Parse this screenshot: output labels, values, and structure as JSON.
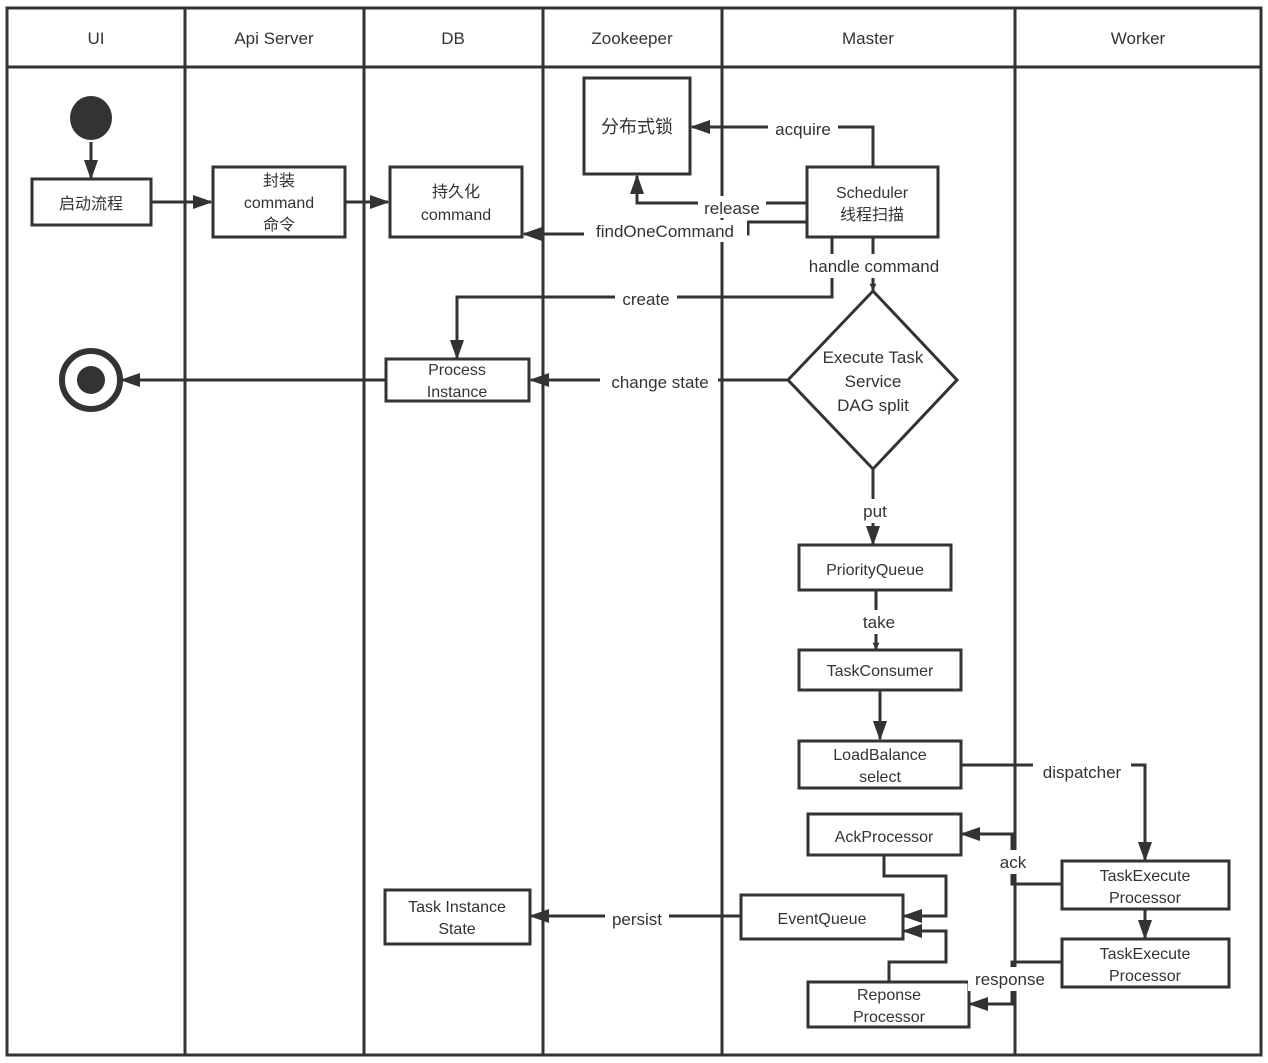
{
  "lanes": [
    {
      "id": "ui",
      "title": "UI"
    },
    {
      "id": "api",
      "title": "Api Server"
    },
    {
      "id": "db",
      "title": "DB"
    },
    {
      "id": "zk",
      "title": "Zookeeper"
    },
    {
      "id": "master",
      "title": "Master"
    },
    {
      "id": "worker",
      "title": "Worker"
    }
  ],
  "nodes": {
    "start": {
      "kind": "start",
      "label": ""
    },
    "end": {
      "kind": "end",
      "label": ""
    },
    "start_process": {
      "lines": [
        "启动流程"
      ]
    },
    "wrap_command": {
      "lines": [
        "封装",
        "command",
        "命令"
      ]
    },
    "persist_command": {
      "lines": [
        "持久化",
        "command"
      ]
    },
    "distributed_lock": {
      "lines": [
        "分布式锁"
      ]
    },
    "scheduler": {
      "lines": [
        "Scheduler",
        "线程扫描"
      ]
    },
    "process_instance": {
      "lines": [
        "Process",
        "Instance"
      ]
    },
    "execute_task_service": {
      "lines": [
        "Execute Task",
        "Service",
        "DAG split"
      ]
    },
    "priority_queue": {
      "lines": [
        "PriorityQueue"
      ]
    },
    "task_consumer": {
      "lines": [
        "TaskConsumer"
      ]
    },
    "load_balance": {
      "lines": [
        "LoadBalance",
        "select"
      ]
    },
    "ack_processor": {
      "lines": [
        "AckProcessor"
      ]
    },
    "event_queue": {
      "lines": [
        "EventQueue"
      ]
    },
    "response_processor": {
      "lines": [
        "Reponse",
        "Processor"
      ]
    },
    "task_instance_state": {
      "lines": [
        "Task Instance",
        "State"
      ]
    },
    "task_execute_processor_1": {
      "lines": [
        "TaskExecute",
        "Processor"
      ]
    },
    "task_execute_processor_2": {
      "lines": [
        "TaskExecute",
        "Processor"
      ]
    }
  },
  "edges": {
    "acquire": "acquire",
    "release": "release",
    "find_one_command": "findOneCommand",
    "handle_command": "handle command",
    "create": "create",
    "change_state": "change state",
    "put": "put",
    "take": "take",
    "dispatcher": "dispatcher",
    "ack": "ack",
    "persist": "persist",
    "response": "response"
  },
  "colors": {
    "stroke": "#333333",
    "text": "#333333",
    "background": "#ffffff"
  }
}
